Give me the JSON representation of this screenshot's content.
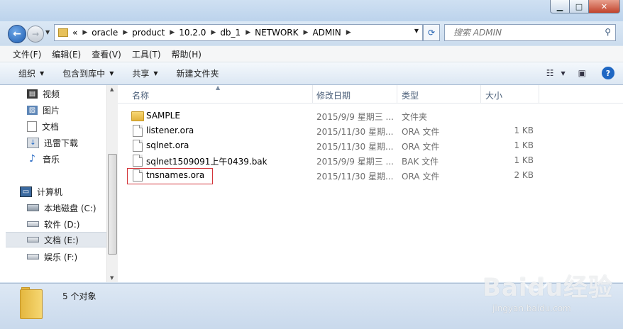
{
  "address": {
    "overflow": "«",
    "crumbs": [
      "oracle",
      "product",
      "10.2.0",
      "db_1",
      "NETWORK",
      "ADMIN"
    ]
  },
  "search": {
    "placeholder": "搜索 ADMIN"
  },
  "menu": [
    "文件(F)",
    "编辑(E)",
    "查看(V)",
    "工具(T)",
    "帮助(H)"
  ],
  "toolbar": {
    "organize": "组织",
    "include": "包含到库中",
    "share": "共享",
    "new_folder": "新建文件夹"
  },
  "nav": {
    "libraries": [
      {
        "label": "视频",
        "icon": "video-library-icon"
      },
      {
        "label": "图片",
        "icon": "pictures-library-icon"
      },
      {
        "label": "文档",
        "icon": "documents-library-icon"
      },
      {
        "label": "迅雷下载",
        "icon": "download-folder-icon"
      },
      {
        "label": "音乐",
        "icon": "music-library-icon"
      }
    ],
    "computer": "计算机",
    "drives": [
      {
        "label": "本地磁盘 (C:)",
        "icon": "system-drive-icon",
        "selected": false
      },
      {
        "label": "软件 (D:)",
        "icon": "drive-icon",
        "selected": false
      },
      {
        "label": "文档 (E:)",
        "icon": "drive-icon",
        "selected": true
      },
      {
        "label": "娱乐 (F:)",
        "icon": "drive-icon",
        "selected": false
      }
    ]
  },
  "columns": {
    "name": "名称",
    "date": "修改日期",
    "type": "类型",
    "size": "大小"
  },
  "files": [
    {
      "name": "SAMPLE",
      "date": "2015/9/9 星期三 ...",
      "type": "文件夹",
      "size": "",
      "icon": "folder-icon"
    },
    {
      "name": "listener.ora",
      "date": "2015/11/30 星期...",
      "type": "ORA 文件",
      "size": "1 KB",
      "icon": "file-icon"
    },
    {
      "name": "sqlnet.ora",
      "date": "2015/11/30 星期...",
      "type": "ORA 文件",
      "size": "1 KB",
      "icon": "file-icon"
    },
    {
      "name": "sqlnet1509091上午0439.bak",
      "date": "2015/9/9 星期三 ...",
      "type": "BAK 文件",
      "size": "1 KB",
      "icon": "file-icon"
    },
    {
      "name": "tnsnames.ora",
      "date": "2015/11/30 星期...",
      "type": "ORA 文件",
      "size": "2 KB",
      "icon": "file-icon"
    }
  ],
  "status": {
    "count": "5 个对象"
  },
  "watermark": {
    "brand": "Baidu经验",
    "url": "jingyan.baidu.com"
  },
  "colors": {
    "highlight_box": "#d3353a",
    "selection": "#e3e8ee",
    "accent": "#1f67c3"
  }
}
